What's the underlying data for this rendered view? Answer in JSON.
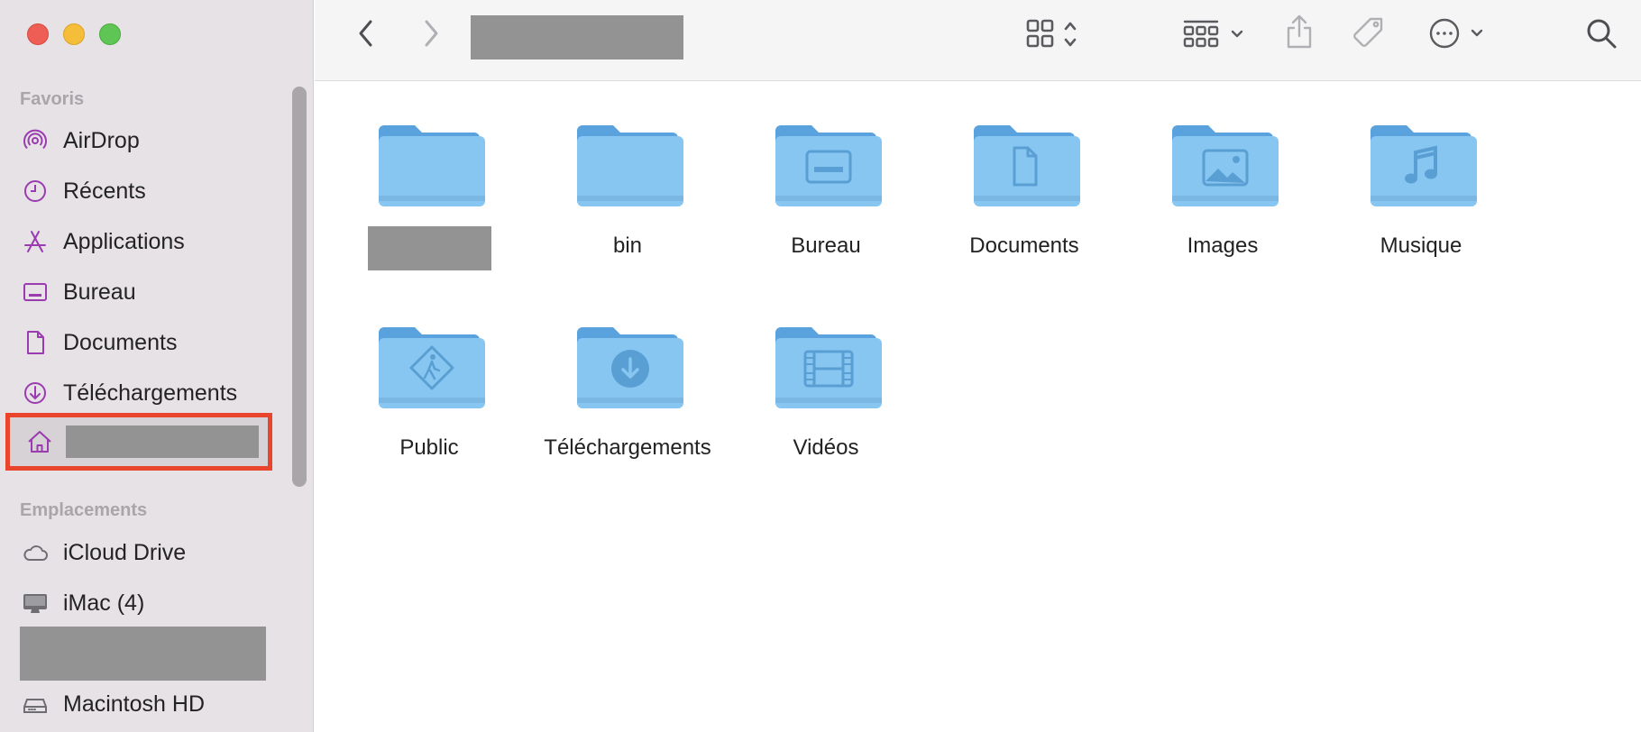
{
  "window": {
    "title_redacted": true
  },
  "sidebar": {
    "favorites_title": "Favoris",
    "favorites": [
      {
        "label": "AirDrop",
        "icon": "airdrop-icon"
      },
      {
        "label": "Récents",
        "icon": "clock-icon"
      },
      {
        "label": "Applications",
        "icon": "applications-icon"
      },
      {
        "label": "Bureau",
        "icon": "desktop-icon"
      },
      {
        "label": "Documents",
        "icon": "document-icon"
      },
      {
        "label": "Téléchargements",
        "icon": "download-icon"
      }
    ],
    "home": {
      "icon": "home-icon",
      "label_redacted": true,
      "highlighted": true
    },
    "locations_title": "Emplacements",
    "locations": [
      {
        "label": "iCloud Drive",
        "icon": "cloud-icon"
      },
      {
        "label": "iMac (4)",
        "icon": "imac-icon"
      },
      {
        "label": "",
        "icon": "",
        "redacted": true
      },
      {
        "label": "Macintosh HD",
        "icon": "disk-icon"
      }
    ],
    "accent_color": "#9a3bb0",
    "highlight_color": "#e8452c"
  },
  "toolbar": {
    "back": "chevron-left-icon",
    "forward": "chevron-right-icon",
    "view": "icon-grid-icon",
    "group": "group-icon",
    "share": "share-icon",
    "tag": "tag-icon",
    "more": "ellipsis-circle-icon",
    "search": "search-icon"
  },
  "content": {
    "folder_color": "#87c6f1",
    "items": [
      {
        "label": "",
        "redacted": true,
        "glyph": "none"
      },
      {
        "label": "bin",
        "glyph": "none"
      },
      {
        "label": "Bureau",
        "glyph": "desktop"
      },
      {
        "label": "Documents",
        "glyph": "document"
      },
      {
        "label": "Images",
        "glyph": "photo"
      },
      {
        "label": "Musique",
        "glyph": "music"
      },
      {
        "label": "Public",
        "glyph": "public"
      },
      {
        "label": "Téléchargements",
        "glyph": "download"
      },
      {
        "label": "Vidéos",
        "glyph": "film"
      }
    ]
  }
}
